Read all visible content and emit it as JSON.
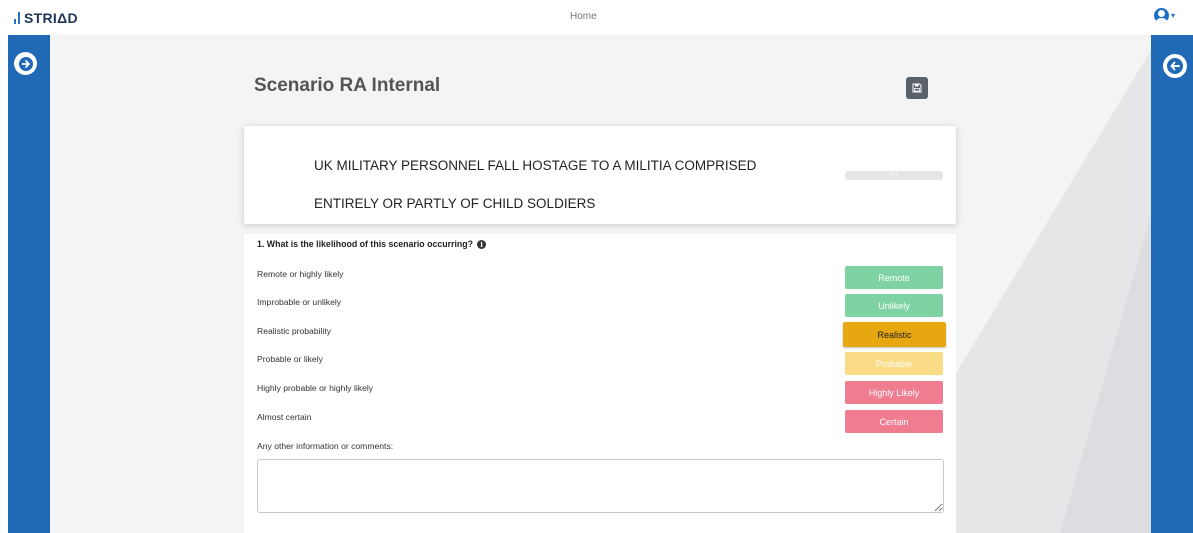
{
  "app": {
    "logo_text": "STRIΔD",
    "nav_home": "Home"
  },
  "page": {
    "title": "Scenario RA Internal"
  },
  "scenario": {
    "line1": "UK MILITARY PERSONNEL FALL HOSTAGE TO A MILITIA COMPRISED",
    "line2": "ENTIRELY OR PARTLY OF CHILD SOLDIERS",
    "progress_label": "0%",
    "progress_value": 0
  },
  "question": {
    "label": "1. What is the likelihood of this scenario occurring?",
    "info_icon": "i",
    "selected": "Realistic",
    "options": [
      {
        "label": "Remote or highly likely",
        "button": "Remote",
        "color": "#7fd3a2"
      },
      {
        "label": "Improbable or unlikely",
        "button": "Unlikely",
        "color": "#7fd3a2"
      },
      {
        "label": "Realistic probability",
        "button": "Realistic",
        "color": "#e7a710"
      },
      {
        "label": "Probable or likely",
        "button": "Probable",
        "color": "#fbdc86"
      },
      {
        "label": "Highly probable or highly likely",
        "button": "Highly Likely",
        "color": "#f07d8f"
      },
      {
        "label": "Almost certain",
        "button": "Certain",
        "color": "#f07d8f"
      }
    ]
  },
  "comments": {
    "label": "Any other information or comments:",
    "value": "",
    "placeholder": ""
  },
  "icons": {
    "sidebar_left": "arrow-right-circle-icon",
    "sidebar_right": "arrow-left-circle-icon",
    "save": "floppy-disk-icon",
    "user": "user-circle-icon"
  },
  "colors": {
    "primary": "#1f69b5",
    "save_button": "#5a6268",
    "background": "#f4f4f5"
  }
}
